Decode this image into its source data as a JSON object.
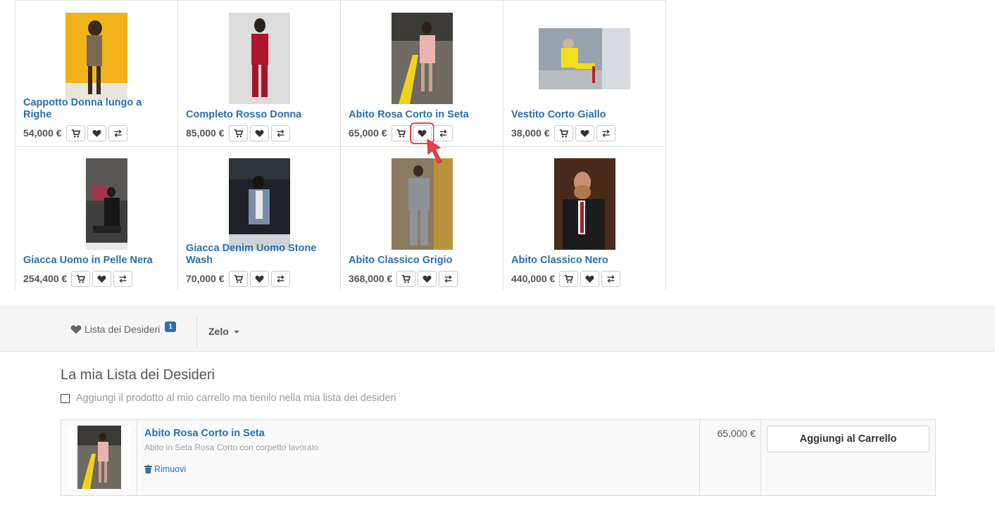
{
  "products": [
    {
      "name": "Cappotto Donna lungo a Righe",
      "price": "54,000 €"
    },
    {
      "name": "Completo Rosso Donna",
      "price": "85,000 €"
    },
    {
      "name": "Abito Rosa Corto in Seta",
      "price": "65,000 €"
    },
    {
      "name": "Vestito Corto Giallo",
      "price": "38,000 €"
    },
    {
      "name": "Giacca Uomo in Pelle Nera",
      "price": "254,400 €"
    },
    {
      "name": "Giacca Denim Uomo Stone Wash",
      "price": "70,000 €"
    },
    {
      "name": "Abito Classico Grigio",
      "price": "368,000 €"
    },
    {
      "name": "Abito Classico Nero",
      "price": "440,000 €"
    }
  ],
  "icons": {
    "cart": "cart-icon",
    "wishlist": "heart-icon",
    "compare": "compare-icon"
  },
  "navbar": {
    "wishlist_label": "Lista dei Desideri",
    "wishlist_count": "1",
    "user_name": "Zelo"
  },
  "wishlist": {
    "title": "La mia Lista dei Desideri",
    "keep_option_label": "Aggiungi il prodotto al mio carrello ma tienilo nella mia lista dei desideri",
    "item": {
      "name": "Abito Rosa Corto in Seta",
      "description": "Abito in Seta Rosa Corto con corpetto lavorato",
      "remove_label": "Rimuovi",
      "price": "65,000 €",
      "add_to_cart_label": "Aggiungi al Carrello"
    }
  },
  "colors": {
    "link": "#2a6fb0",
    "highlight": "#e8424d",
    "badge": "#2a6fb0"
  }
}
